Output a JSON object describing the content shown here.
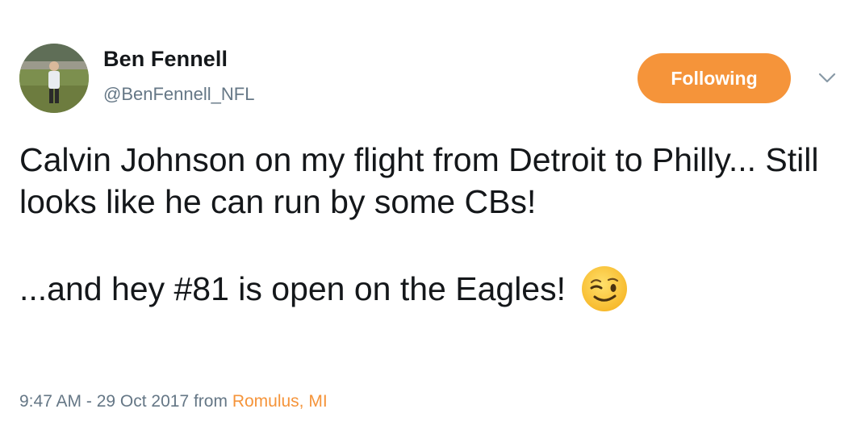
{
  "tweet": {
    "author": {
      "display_name": "Ben Fennell",
      "handle": "@BenFennell_NFL"
    },
    "follow_button_label": "Following",
    "text": {
      "paragraph1": "Calvin Johnson on my flight from Detroit to Philly... Still looks like he can run by some CBs!",
      "paragraph2": "...and hey #81 is open on the Eagles!"
    },
    "emoji": "winking-face-emoji",
    "meta": {
      "timestamp": "9:47 AM - 29 Oct 2017",
      "from_label": "from",
      "location": "Romulus, MI"
    }
  },
  "colors": {
    "accent": "#f5943a",
    "text_primary": "#14171a",
    "text_secondary": "#657786",
    "background": "#ffffff"
  },
  "icons": {
    "caret": "chevron-down-icon"
  }
}
